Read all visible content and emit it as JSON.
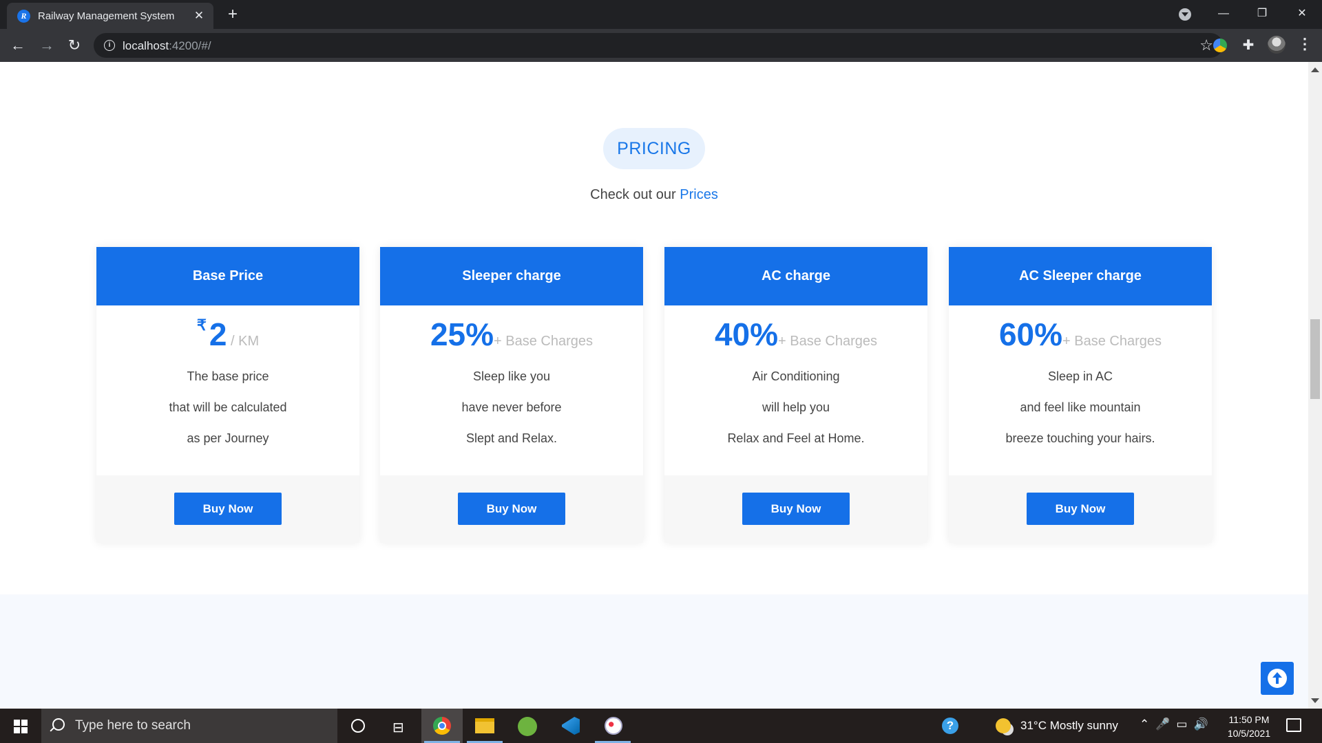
{
  "browser": {
    "tab_title": "Railway Management System",
    "favicon_letter": "R",
    "url_host": "localhost",
    "url_path": ":4200/#/"
  },
  "section": {
    "badge": "PRICING",
    "subtitle_prefix": "Check out our",
    "subtitle_highlight": "Prices"
  },
  "cards": [
    {
      "title": "Base Price",
      "currency": "₹",
      "value": "2",
      "unit": " / KM",
      "lines": [
        "The base price",
        "that will be calculated",
        "as per Journey"
      ],
      "button": "Buy Now"
    },
    {
      "title": "Sleeper charge",
      "value": "25%",
      "unit": "+ Base Charges",
      "lines": [
        "Sleep like you",
        "have never before",
        "Slept and Relax."
      ],
      "button": "Buy Now"
    },
    {
      "title": "AC charge",
      "value": "40%",
      "unit": "+ Base Charges",
      "lines": [
        "Air Conditioning",
        "will help you",
        "Relax and Feel at Home."
      ],
      "button": "Buy Now"
    },
    {
      "title": "AC Sleeper charge",
      "value": "60%",
      "unit": "+ Base Charges",
      "lines": [
        "Sleep in AC",
        "and feel like mountain",
        "breeze touching your hairs."
      ],
      "button": "Buy Now"
    }
  ],
  "taskbar": {
    "search_placeholder": "Type here to search",
    "weather": "31°C  Mostly sunny",
    "time": "11:50 PM",
    "date": "10/5/2021"
  },
  "colors": {
    "accent": "#1570e8",
    "badge_bg": "#e7f1fd",
    "footer_bg": "#f7f7f7"
  },
  "icons": [
    "back-arrow-icon",
    "forward-arrow-icon",
    "reload-icon",
    "info-icon",
    "star-icon",
    "extensions-icon",
    "back-to-top-icon",
    "windows-start-icon",
    "search-icon"
  ]
}
